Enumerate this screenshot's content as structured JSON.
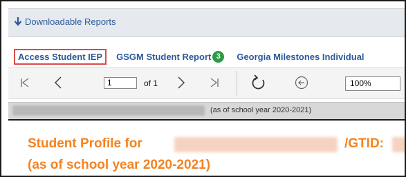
{
  "header": {
    "downloadable_reports_label": "Downloadable Reports"
  },
  "tabs": [
    {
      "label": "Access Student IEP"
    },
    {
      "label": "GSGM Student Report",
      "badge": "3"
    },
    {
      "label": "Georgia Milestones Individual"
    }
  ],
  "toolbar": {
    "page_value": "1",
    "of_label": "of 1",
    "zoom_value": "100%"
  },
  "year_bar": {
    "text": "(as of school year 2020-2021)"
  },
  "profile": {
    "title": "Student Profile for",
    "gtid_label": "/GTID:",
    "subtitle": "(as of school year 2020-2021)"
  },
  "colors": {
    "link": "#2a5a9a",
    "accent_orange": "#f5821f",
    "badge_green": "#2e9a46",
    "highlight_red": "#e04848"
  }
}
